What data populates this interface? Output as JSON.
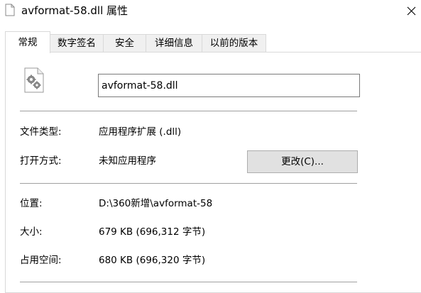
{
  "window": {
    "title": "avformat-58.dll 属性",
    "close_icon": "close-icon",
    "file_icon": "dll-file-icon"
  },
  "tabs": [
    {
      "label": "常规",
      "active": true
    },
    {
      "label": "数字签名",
      "active": false
    },
    {
      "label": "安全",
      "active": false
    },
    {
      "label": "详细信息",
      "active": false
    },
    {
      "label": "以前的版本",
      "active": false
    }
  ],
  "general": {
    "file_name": "avformat-58.dll",
    "file_type_label": "文件类型:",
    "file_type_value": "应用程序扩展 (.dll)",
    "opens_with_label": "打开方式:",
    "opens_with_value": "未知应用程序",
    "change_button_label": "更改(C)...",
    "location_label": "位置:",
    "location_value": "D:\\360新增\\avformat-58",
    "size_label": "大小:",
    "size_value": "679 KB (696,312 字节)",
    "size_on_disk_label": "占用空间:",
    "size_on_disk_value": "680 KB (696,320 字节)"
  }
}
